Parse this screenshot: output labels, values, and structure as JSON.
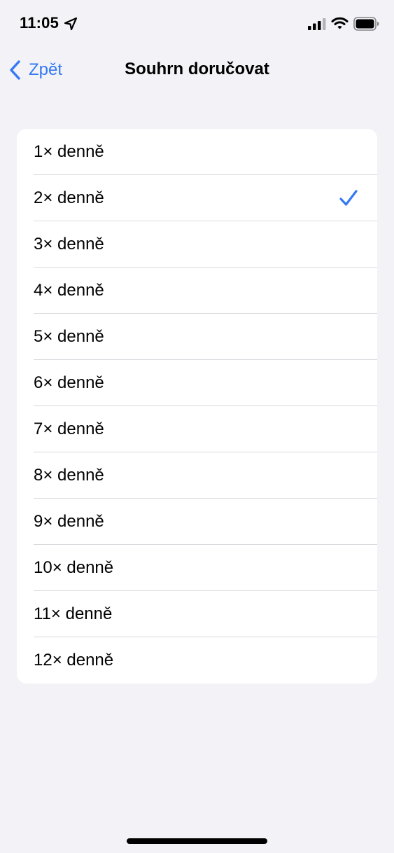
{
  "status_bar": {
    "time": "11:05",
    "icons": [
      "location-icon",
      "signal-icon",
      "wifi-icon",
      "battery-icon"
    ]
  },
  "nav": {
    "back_label": "Zpět",
    "back_icon": "chevron-left-icon",
    "title": "Souhrn doručovat"
  },
  "options": [
    {
      "label": "1× denně",
      "selected": false
    },
    {
      "label": "2× denně",
      "selected": true
    },
    {
      "label": "3× denně",
      "selected": false
    },
    {
      "label": "4× denně",
      "selected": false
    },
    {
      "label": "5× denně",
      "selected": false
    },
    {
      "label": "6× denně",
      "selected": false
    },
    {
      "label": "7× denně",
      "selected": false
    },
    {
      "label": "8× denně",
      "selected": false
    },
    {
      "label": "9× denně",
      "selected": false
    },
    {
      "label": "10× denně",
      "selected": false
    },
    {
      "label": "11× denně",
      "selected": false
    },
    {
      "label": "12× denně",
      "selected": false
    }
  ],
  "colors": {
    "accent": "#3478f6",
    "background": "#f2f2f7",
    "card": "#ffffff",
    "separator": "#d9d9de"
  }
}
